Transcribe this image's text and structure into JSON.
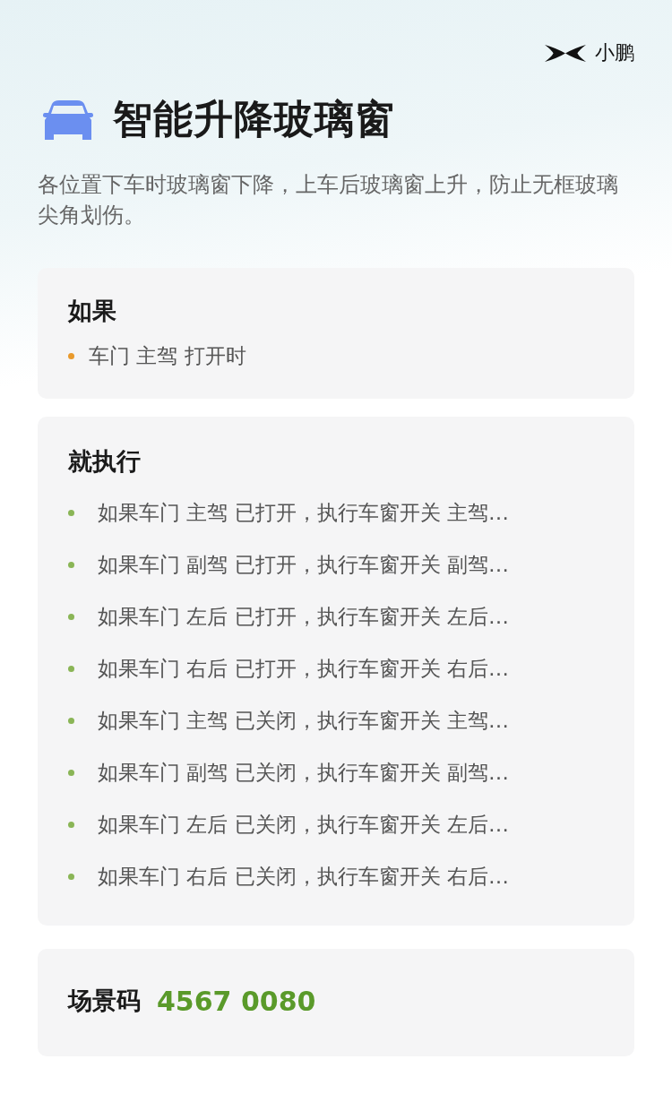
{
  "brand": {
    "name": "小鹏"
  },
  "header": {
    "title": "智能升降玻璃窗",
    "description": "各位置下车时玻璃窗下降，上车后玻璃窗上升，防止无框玻璃尖角划伤。"
  },
  "sections": [
    {
      "kind": "condition",
      "heading": "如果",
      "items": [
        "车门 主驾 打开时"
      ]
    },
    {
      "kind": "action",
      "heading": "就执行",
      "items": [
        "如果车门 主驾 已打开，执行车窗开关 主驾…",
        "如果车门 副驾 已打开，执行车窗开关 副驾…",
        "如果车门 左后 已打开，执行车窗开关 左后…",
        "如果车门 右后 已打开，执行车窗开关 右后…",
        "如果车门 主驾 已关闭，执行车窗开关 主驾…",
        "如果车门 副驾 已关闭，执行车窗开关 副驾…",
        "如果车门 左后 已关闭，执行车窗开关 左后…",
        "如果车门 右后 已关闭，执行车窗开关 右后…"
      ]
    },
    {
      "kind": "code",
      "heading": "场景码",
      "code": "4567 0080"
    }
  ]
}
